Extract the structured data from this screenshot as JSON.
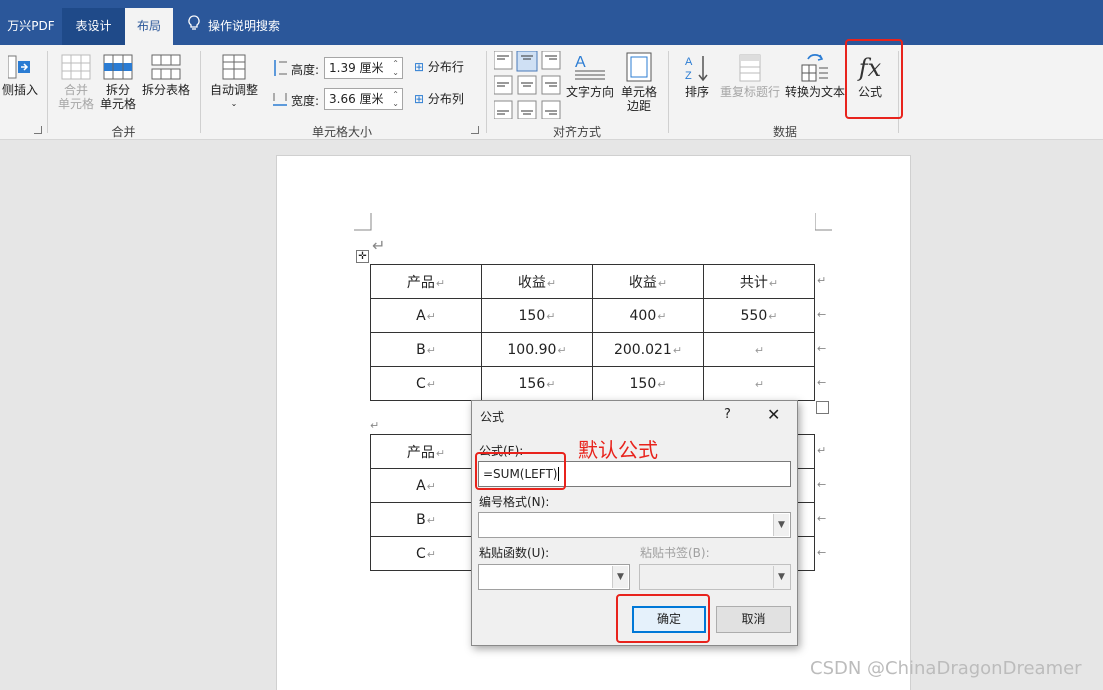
{
  "window": {
    "title_partial": ""
  },
  "tabs": [
    {
      "label": "万兴PDF"
    },
    {
      "label": "表设计"
    },
    {
      "label": "布局"
    }
  ],
  "tell_me": {
    "label": "操作说明搜索",
    "icon": "lightbulb-icon"
  },
  "ribbon": {
    "rows_cols": {
      "insert_side_label": "侧插入"
    },
    "merge": {
      "merge_cells": "合并\n单元格",
      "split_cells": "拆分\n单元格",
      "split_table": "拆分表格",
      "group_label": "合并"
    },
    "cell_size": {
      "autofit": "自动调整",
      "height_label": "高度:",
      "height_value": "1.39 厘米",
      "width_label": "宽度:",
      "width_value": "3.66 厘米",
      "distribute_rows": "分布行",
      "distribute_cols": "分布列",
      "group_label": "单元格大小"
    },
    "alignment": {
      "text_direction": "文字方向",
      "cell_margins": "单元格\n边距",
      "group_label": "对齐方式"
    },
    "data": {
      "sort": "排序",
      "repeat_header": "重复标题行",
      "convert_to_text": "转换为文本",
      "formula": "公式",
      "formula_glyph": "fx",
      "group_label": "数据"
    }
  },
  "document": {
    "table1": {
      "rows": [
        [
          "产品",
          "收益",
          "收益",
          "共计"
        ],
        [
          "A",
          "150",
          "400",
          "550"
        ],
        [
          "B",
          "100.90",
          "200.021",
          ""
        ],
        [
          "C",
          "156",
          "150",
          ""
        ]
      ]
    },
    "table2": {
      "rows": [
        [
          "产品"
        ],
        [
          "A"
        ],
        [
          "B"
        ],
        [
          "C"
        ]
      ]
    }
  },
  "dialog": {
    "title": "公式",
    "help": "?",
    "close": "✕",
    "formula_label": "公式(F):",
    "formula_value": "=SUM(LEFT)",
    "number_format_label": "编号格式(N):",
    "paste_function_label": "粘贴函数(U):",
    "paste_bookmark_label": "粘贴书签(B):",
    "ok_label": "确定",
    "cancel_label": "取消"
  },
  "annotation": {
    "text": "默认公式",
    "color": "#e8231c"
  },
  "watermark": {
    "text": "CSDN @ChinaDragonDreamer"
  },
  "colors": {
    "ribbon_blue": "#2b579a",
    "highlight_red": "#e8231c",
    "button_focus": "#0078d7"
  }
}
